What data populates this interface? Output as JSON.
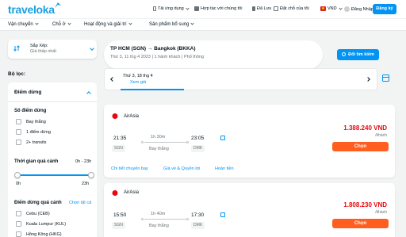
{
  "header": {
    "logo": "traveloka",
    "nav": [
      {
        "label": "Tải ứng dụng",
        "icon": "phone-icon"
      },
      {
        "label": "Hợp tác với chúng tôi",
        "icon": "handshake-icon"
      },
      {
        "label": "Đã Lưu",
        "icon": "bookmark-icon"
      },
      {
        "label": "Đặt chỗ của tôi",
        "icon": "booking-icon"
      },
      {
        "label": "VND",
        "icon": "vn-flag-icon"
      },
      {
        "label": "Đăng Nhập",
        "icon": "user-icon"
      }
    ],
    "register": "Đăng ký"
  },
  "menu": [
    "Vận chuyển",
    "Chỗ ở",
    "Hoạt động và giải trí",
    "Sản phẩm bổ sung"
  ],
  "sort": {
    "label": "Sắp Xếp:",
    "value": "Giá thấp nhất"
  },
  "filter": {
    "title": "Bộ lọc:",
    "section": "Điểm dừng",
    "stops_title": "Số điểm dừng",
    "stops": [
      "Bay thẳng",
      "1 điểm dừng",
      "2+ transits"
    ],
    "time_title": "Thời gian quá cảnh",
    "time_range": "0h - 23h",
    "time_min": "0h",
    "time_max": "23h",
    "via_title": "Điểm dừng quá cảnh",
    "via_link": "Chọn tất cả",
    "airports": [
      "Cebu (CEB)",
      "Kuala Lumpur (KUL)",
      "Hồng Kông (HKG)"
    ]
  },
  "route": {
    "title": "TP HCM (SGN) → Bangkok (BKKA)",
    "subtitle": "Thứ 3, 11 thg 4 2023 | 1 hành khách | Phổ thông",
    "change_button": "Đổi tìm kiếm"
  },
  "date_bar": {
    "date": "Thứ 3, 18 thg 4",
    "link": "Xem giá"
  },
  "flights": [
    {
      "airline": "AirAsia",
      "dep_time": "21:35",
      "dep_apt": "SGN",
      "duration": "1h 30m",
      "type": "Bay thẳng",
      "arr_time": "23:05",
      "arr_apt": "DMK",
      "price": "1.388.240 VND",
      "per": "/khách",
      "choose": "Chọn",
      "links": [
        "Chi tiết chuyến bay",
        "Giá vé & Quyền lợi",
        "Hoàn tiền"
      ]
    },
    {
      "airline": "AirAsia",
      "dep_time": "15:50",
      "dep_apt": "SGN",
      "duration": "1h 40m",
      "type": "Bay thẳng",
      "arr_time": "17:30",
      "arr_apt": "DMK",
      "price": "1.808.230 VND",
      "per": "/khách",
      "choose": "Chọn"
    }
  ],
  "colors": {
    "brand": "#0194f3",
    "price": "#e7090e",
    "cta": "#ff5e1f"
  }
}
